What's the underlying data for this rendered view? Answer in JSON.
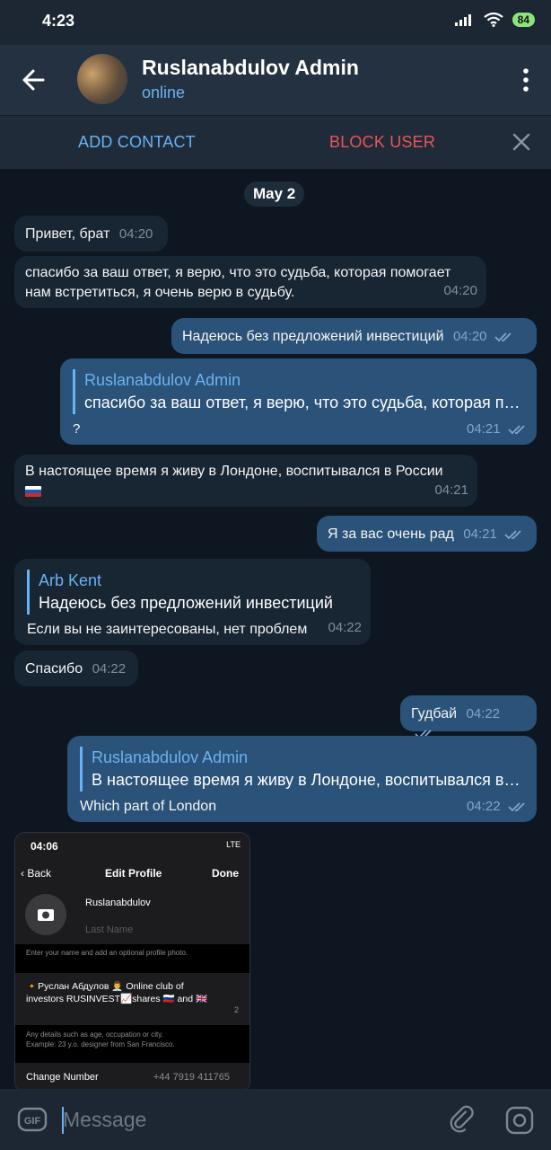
{
  "status_bar": {
    "time": "4:23",
    "battery": "84"
  },
  "header": {
    "title": "Ruslanabdulov Admin",
    "status": "online"
  },
  "actions": {
    "add_contact": "ADD CONTACT",
    "block_user": "BLOCK USER"
  },
  "date_separator": "May 2",
  "messages": [
    {
      "direction": "in",
      "text": "Привет, брат",
      "time": "04:20"
    },
    {
      "direction": "in",
      "text_line1": "спасибо за ваш ответ, я верю, что это судьба, которая помогает",
      "text_line2": "нам встретиться, я очень верю в судьбу.",
      "time": "04:20"
    },
    {
      "direction": "out",
      "text": "Надеюсь без предложений инвестиций",
      "time": "04:20"
    },
    {
      "direction": "out",
      "reply_name": "Ruslanabdulov Admin",
      "reply_text": "спасибо за ваш ответ, я верю, что это судьба, которая помогает нам встретиться",
      "text": "?",
      "time": "04:21"
    },
    {
      "direction": "in",
      "text": "В настоящее время я живу в Лондоне, воспитывался в России",
      "time": "04:21"
    },
    {
      "direction": "out",
      "text": "Я за вас очень рад",
      "time": "04:21"
    },
    {
      "direction": "in",
      "reply_name": "Arb Kent",
      "reply_text": "Надеюсь без предложений инвестиций",
      "text": "Если вы не заинтересованы, нет проблем",
      "time": "04:22"
    },
    {
      "direction": "in",
      "text": "Спасибо",
      "time": "04:22"
    },
    {
      "direction": "out",
      "text": "Гудбай",
      "time": "04:22"
    },
    {
      "direction": "out",
      "reply_name": "Ruslanabdulov Admin",
      "reply_text": "В настоящее время я живу в Лондоне, воспитывался в России",
      "text": "Which part of London",
      "time": "04:22"
    }
  ],
  "shared_screenshot": {
    "time": "04:06",
    "network": "LTE",
    "back": "Back",
    "title": "Edit Profile",
    "done": "Done",
    "first_name": "Ruslanabdulov",
    "last_name_placeholder": "Last Name",
    "name_hint": "Enter your name and add an optional profile photo.",
    "bio": "🔸Руслан Абдулов 👨‍💼 Online club of investors RUSINVEST📈shares 🇷🇺 and 🇬🇧",
    "bio_count": "2",
    "bio_hint_line1": "Any details such as age, occupation or city.",
    "bio_hint_line2": "Example: 23 y.o. designer from San Francisco.",
    "row_label": "Change Number",
    "row_value": "+44 7919 411765"
  },
  "input": {
    "placeholder": "Message"
  },
  "colors": {
    "accent": "#6ab2f2",
    "danger": "#e5575b",
    "outgoing_bubble": "#2b5278",
    "incoming_bubble": "#182533",
    "background": "#0e1621"
  }
}
